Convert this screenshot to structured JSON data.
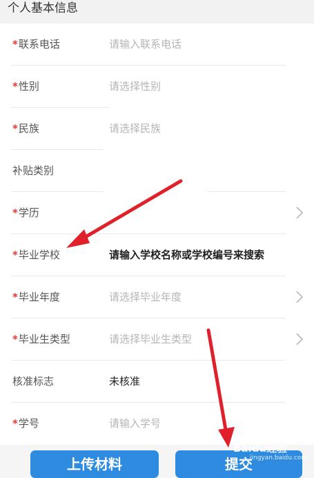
{
  "header": {
    "title": "个人基本信息"
  },
  "required_mark": "*",
  "rows": [
    {
      "label": "联系电话",
      "value": "请输入联系电话",
      "required": true
    },
    {
      "label": "性别",
      "value": "请选择性别",
      "required": true
    },
    {
      "label": "民族",
      "value": "请选择民族",
      "required": true
    },
    {
      "label": "补贴类别",
      "value": "",
      "required": false
    },
    {
      "label": "学历",
      "value": "",
      "required": true
    },
    {
      "label": "毕业学校",
      "value": "请输入学校名称或学校编号来搜索",
      "required": true
    },
    {
      "label": "毕业年度",
      "value": "请选择毕业年度",
      "required": true
    },
    {
      "label": "毕业生类型",
      "value": "请选择毕业生类型",
      "required": true
    },
    {
      "label": "核准标志",
      "value": "未核准",
      "required": false
    },
    {
      "label": "学号",
      "value": "请输入学号",
      "required": true
    }
  ],
  "buttons": {
    "upload": "上传材料",
    "submit": "提交"
  },
  "watermark": {
    "brand": "Baidu经验",
    "url": "jingyan.baidu.com"
  },
  "colors": {
    "accent": "#2f8be0",
    "required": "#e53935",
    "arrow": "#e0202a"
  }
}
